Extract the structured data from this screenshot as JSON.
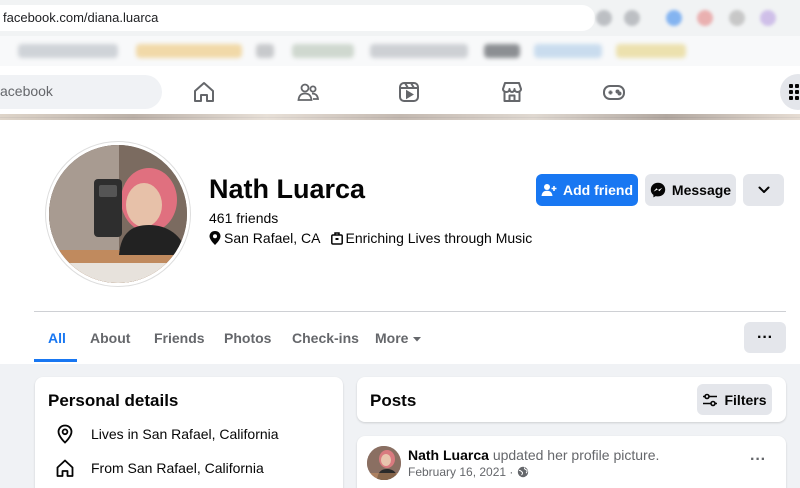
{
  "browser": {
    "url": "facebook.com/diana.luarca"
  },
  "nav": {
    "search_placeholder": "acebook"
  },
  "profile": {
    "name": "Nath Luarca",
    "friends": "461 friends",
    "location": "San Rafael, CA",
    "work": "Enriching Lives through Music"
  },
  "actions": {
    "add_friend": "Add friend",
    "message": "Message"
  },
  "tabs": [
    "All",
    "About",
    "Friends",
    "Photos",
    "Check-ins",
    "More"
  ],
  "tabs_menu": "···",
  "personal_details": {
    "title": "Personal details",
    "lives_in": "Lives in San Rafael, California",
    "from": "From San Rafael, California"
  },
  "posts": {
    "title": "Posts",
    "filters": "Filters"
  },
  "post": {
    "author": "Nath Luarca",
    "action": "updated her profile picture.",
    "date": "February 16, 2021 ·",
    "more": "···"
  },
  "colors": {
    "accent": "#1877f2",
    "secondary_bg": "#e4e6eb",
    "page_bg": "#f0f2f5"
  }
}
